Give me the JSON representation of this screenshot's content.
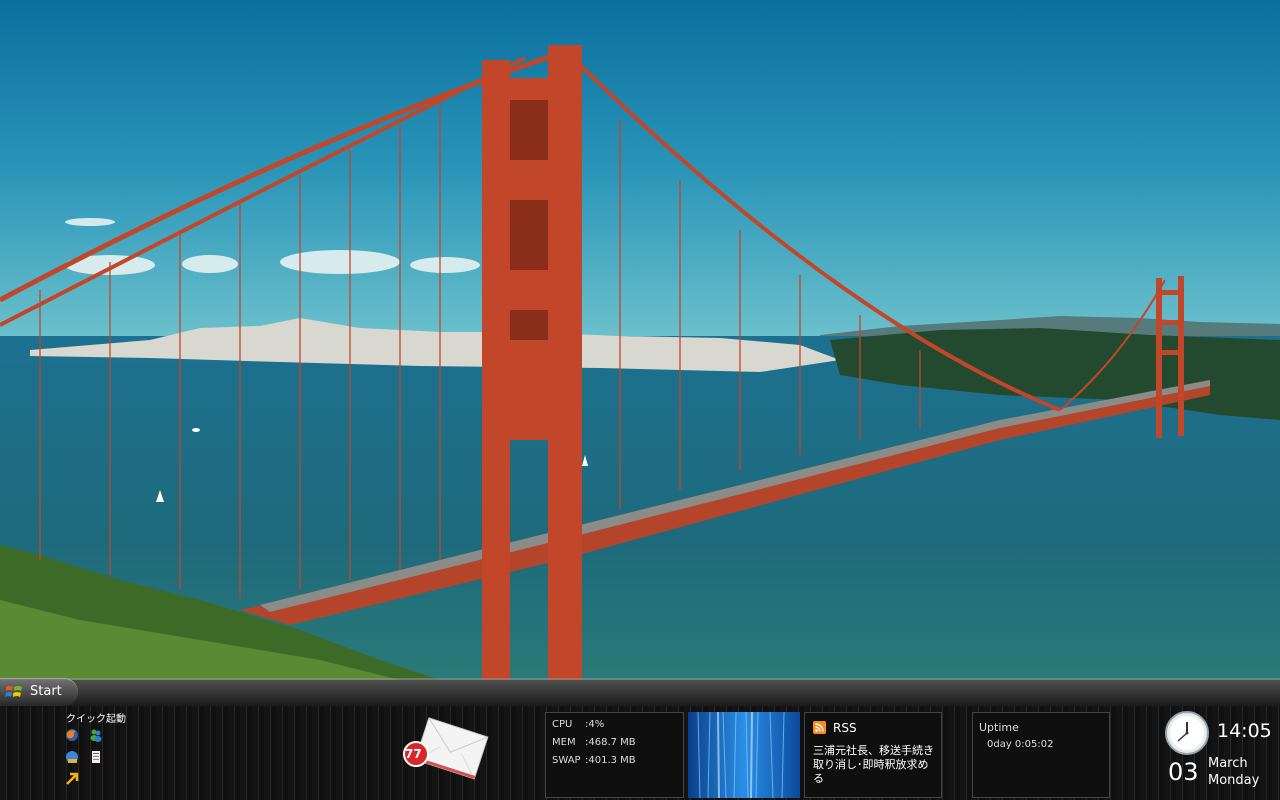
{
  "taskbar": {
    "start_label": "Start"
  },
  "quick_launch": {
    "title": "クイック起動",
    "icons": [
      "firefox-icon",
      "messenger-icon",
      "browser-icon",
      "notepad-icon",
      "arrow-icon"
    ]
  },
  "mail": {
    "unread_count": "77"
  },
  "system": {
    "cpu_label": "CPU",
    "cpu_value": ":4%",
    "mem_label": "MEM",
    "mem_value": ":468.7 MB",
    "swap_label": "SWAP",
    "swap_value": ":401.3 MB"
  },
  "rss": {
    "title": "RSS",
    "headline": "三浦元社長、移送手続き取り消し･即時釈放求める"
  },
  "uptime": {
    "title": "Uptime",
    "value": "0day 0:05:02"
  },
  "clock": {
    "time": "14:05",
    "day": "03",
    "month": "March",
    "weekday": "Monday"
  },
  "colors": {
    "bridge": "#c0452a",
    "sky": "#1c8ab8",
    "water": "#1b6f8a",
    "rss_orange": "#f58c1e",
    "badge_red": "#d62828"
  }
}
